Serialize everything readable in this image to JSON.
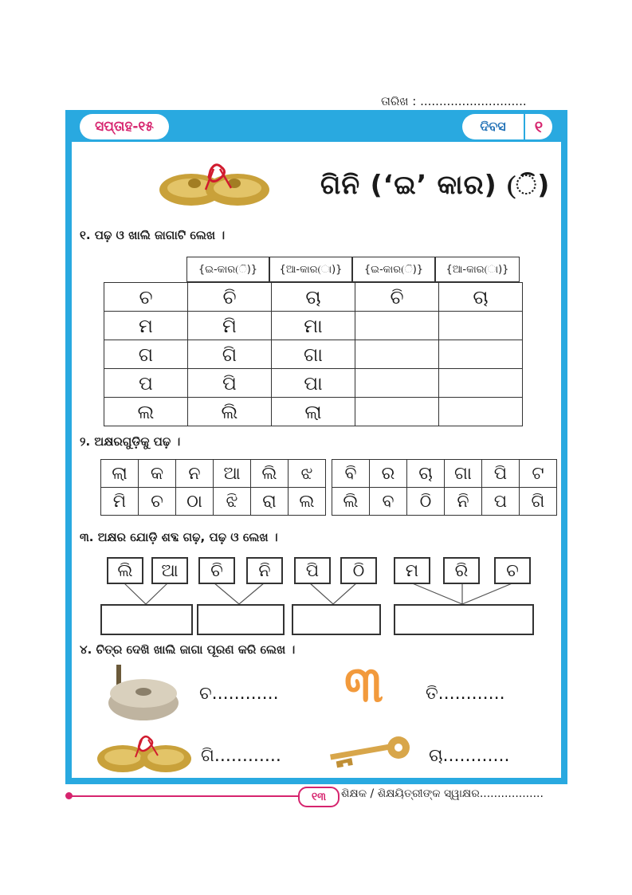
{
  "date_label": "ତାରିଖ : ............................",
  "week_badge": "ସପ୍ତାହ-୧୫",
  "day_badge": {
    "label": "ଦିବସ",
    "number": "୧"
  },
  "title": "ଗିନି  (‘ଇ’ କାର) (ି)",
  "q1": {
    "instruction": "୧. ପଢ଼ ଓ ଖାଲି ଜାଗାଟି ଲେଖ ।",
    "headers": [
      "{ଇ-କାର(ି)}",
      "{ଆ-କାର(ା)}",
      "{ଇ-କାର(ି)}",
      "{ଆ-କାର(ା)}"
    ],
    "rows": [
      [
        "ଚ",
        "ଚି",
        "ଚା",
        "ଚି",
        "ଚା"
      ],
      [
        "ମ",
        "ମି",
        "ମା",
        "",
        ""
      ],
      [
        "ଗ",
        "ଗି",
        "ଗା",
        "",
        ""
      ],
      [
        "ପ",
        "ପି",
        "ପା",
        "",
        ""
      ],
      [
        "ଲ",
        "ଲି",
        "ଲା",
        "",
        ""
      ]
    ]
  },
  "q2": {
    "instruction": "୨. ଅକ୍ଷରଗୁଡ଼ିକୁ ପଢ଼ ।",
    "left": [
      [
        "ଲା",
        "କ",
        "ନ",
        "ଆ",
        "ଲି",
        "ଝ"
      ],
      [
        "ମି",
        "ଚ",
        "ଠା",
        "ଝି",
        "ରା",
        "ଲ"
      ]
    ],
    "right": [
      [
        "ବି",
        "ର",
        "ଚା",
        "ଗା",
        "ପି",
        "ଟ"
      ],
      [
        "ଲି",
        "ବ",
        "ଠି",
        "ନି",
        "ପ",
        "ଗି"
      ]
    ]
  },
  "q3": {
    "instruction": "୩. ଅକ୍ଷର ଯୋଡ଼ି ଶବ୍ଦ ଗଢ଼, ପଢ଼ ଓ ଲେଖ ।",
    "syllables": [
      "ଲି",
      "ଆ",
      "ଚି",
      "ନି",
      "ପି",
      "ଠି",
      "ମ",
      "ରି",
      "ଚ"
    ]
  },
  "q4": {
    "instruction": "୪. ଚିତ୍ର ଦେଖି ଖାଲି ଜାଗା ପୂରଣ କରି ଲେଖ ।",
    "items": [
      "ଚ............",
      "ତି............",
      "ଗି............",
      "ଚା............"
    ],
    "numeral": "୩"
  },
  "footer": {
    "page_number": "୧୩",
    "signature": "ଶିକ୍ଷକ / ଶିକ୍ଷୟିତ୍ରୀଙ୍କ ସ୍ୱାକ୍ଷର.................."
  }
}
